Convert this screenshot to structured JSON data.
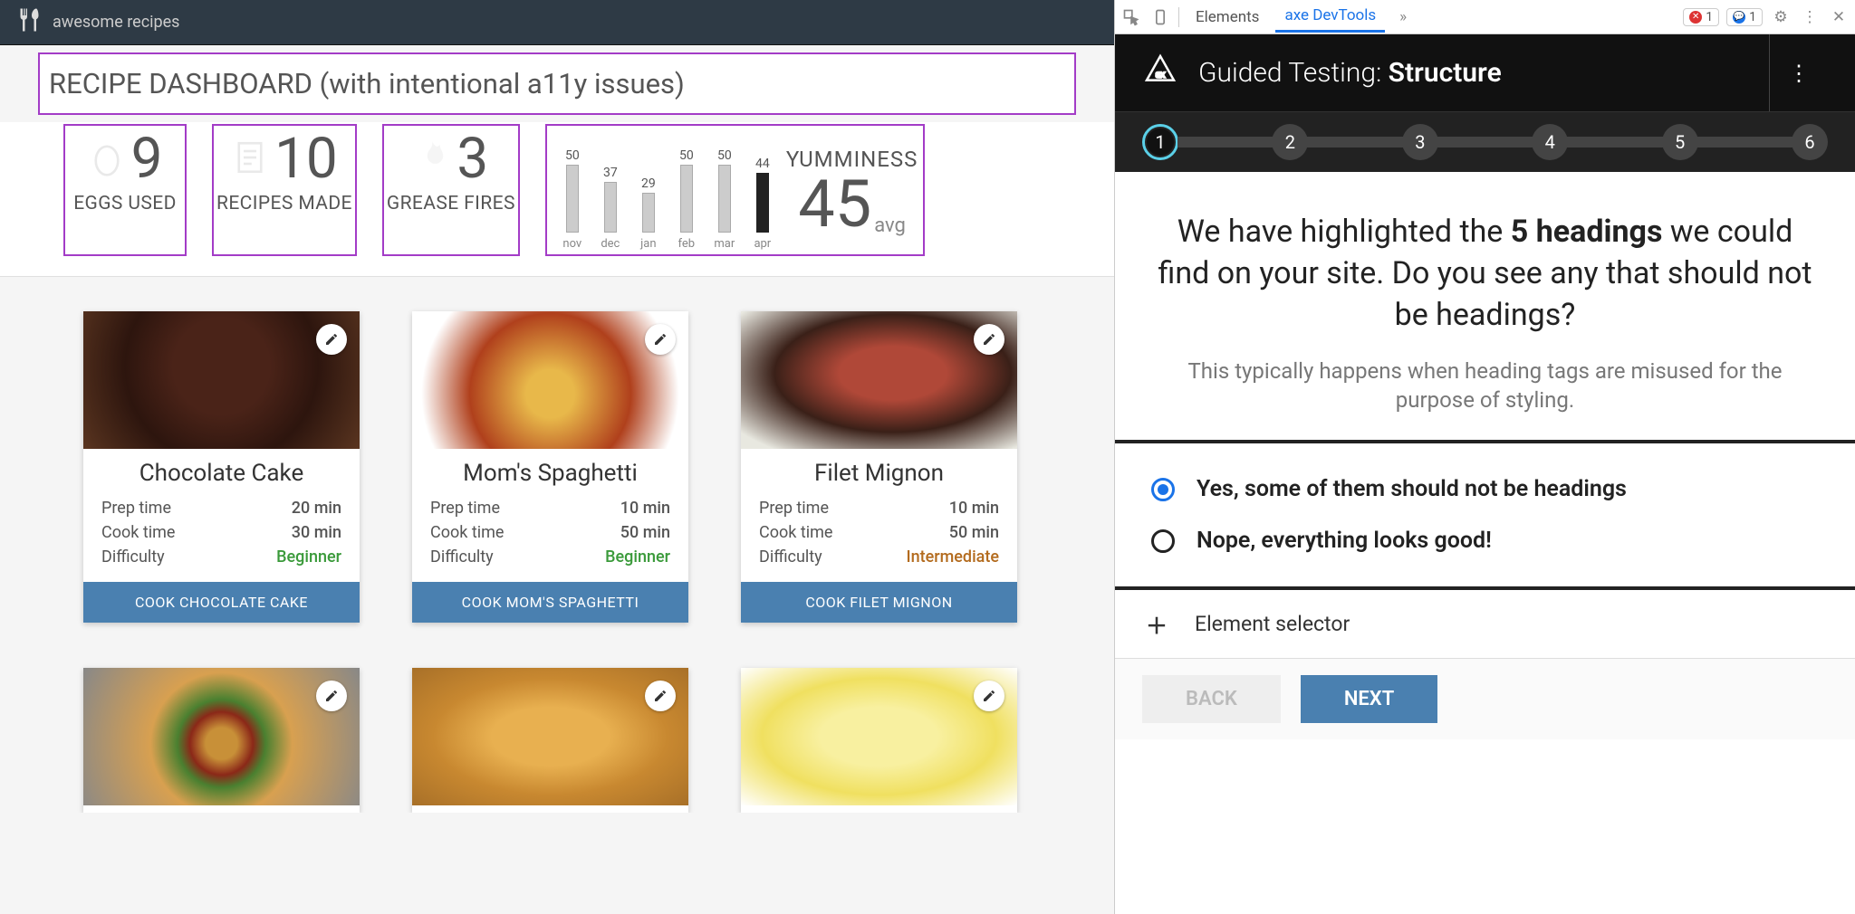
{
  "header": {
    "brand": "awesome recipes"
  },
  "page_title": "RECIPE DASHBOARD (with intentional a11y issues)",
  "stats": [
    {
      "value": "9",
      "label": "EGGS USED",
      "icon": "egg-icon"
    },
    {
      "value": "10",
      "label": "RECIPES MADE",
      "icon": "recipe-icon"
    },
    {
      "value": "3",
      "label": "GREASE FIRES",
      "icon": "flame-icon"
    }
  ],
  "chart_data": {
    "type": "bar",
    "title": "YUMMINESS",
    "categories": [
      "nov",
      "dec",
      "jan",
      "feb",
      "mar",
      "apr"
    ],
    "values": [
      50,
      37,
      29,
      50,
      50,
      44
    ],
    "ylim": [
      0,
      60
    ],
    "average": 45,
    "avg_label": "avg"
  },
  "recipes": [
    {
      "name": "Chocolate Cake",
      "prep": "20 min",
      "cook": "30 min",
      "difficulty": "Beginner",
      "cook_label": "COOK CHOCOLATE CAKE"
    },
    {
      "name": "Mom's Spaghetti",
      "prep": "10 min",
      "cook": "50 min",
      "difficulty": "Beginner",
      "cook_label": "COOK MOM'S SPAGHETTI"
    },
    {
      "name": "Filet Mignon",
      "prep": "10 min",
      "cook": "50 min",
      "difficulty": "Intermediate",
      "cook_label": "COOK FILET MIGNON"
    },
    {
      "name": "",
      "prep": "",
      "cook": "",
      "difficulty": "",
      "cook_label": ""
    },
    {
      "name": "",
      "prep": "",
      "cook": "",
      "difficulty": "",
      "cook_label": ""
    },
    {
      "name": "",
      "prep": "",
      "cook": "",
      "difficulty": "",
      "cook_label": ""
    }
  ],
  "recipe_labels": {
    "prep": "Prep time",
    "cook": "Cook time",
    "difficulty": "Difficulty"
  },
  "devtools": {
    "tabs": {
      "elements": "Elements",
      "axe": "axe DevTools"
    },
    "errors": "1",
    "messages": "1",
    "panel_title_prefix": "Guided Testing: ",
    "panel_title_bold": "Structure",
    "steps": [
      "1",
      "2",
      "3",
      "4",
      "5",
      "6"
    ],
    "question_pre": "We have highlighted the ",
    "question_bold": "5 headings",
    "question_post": " we could find on your site. Do you see any that should not be headings?",
    "subtext": "This typically happens when heading tags are misused for the purpose of styling.",
    "options": [
      "Yes, some of them should not be headings",
      "Nope, everything looks good!"
    ],
    "selected_option": 0,
    "element_selector": "Element selector",
    "back": "BACK",
    "next": "NEXT"
  }
}
